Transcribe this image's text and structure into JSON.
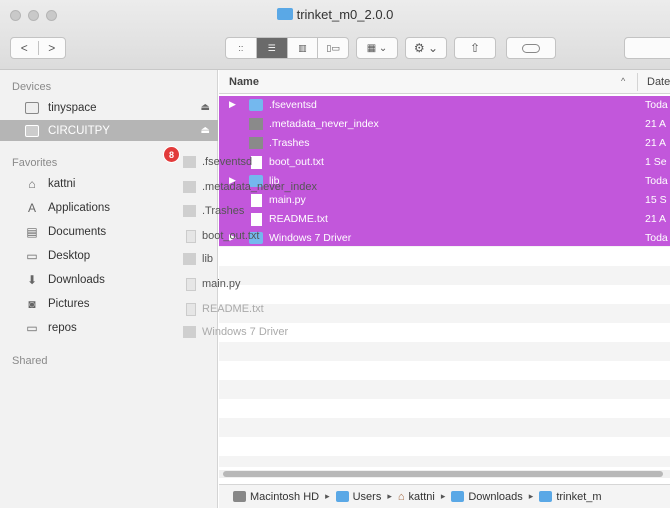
{
  "window": {
    "title": "trinket_m0_2.0.0"
  },
  "toolbar": {
    "back": "<",
    "forward": ">",
    "view_icon": "::",
    "view_list": "☰",
    "view_column": "▥",
    "view_cover": "▯▭",
    "arrange": "▦ ⌄",
    "action": "⚙ ⌄",
    "share": "⇧"
  },
  "sidebar": {
    "devices_heading": "Devices",
    "devices": [
      {
        "label": "tinyspace",
        "icon": "drive-icon"
      },
      {
        "label": "CIRCUITPY",
        "icon": "drive-icon"
      }
    ],
    "eject_glyph": "⏏",
    "favorites_heading": "Favorites",
    "favorites": [
      {
        "label": "kattni",
        "icon": "home-icon",
        "glyph": "⌂"
      },
      {
        "label": "Applications",
        "icon": "applications-icon",
        "glyph": "A"
      },
      {
        "label": "Documents",
        "icon": "documents-icon",
        "glyph": "▤"
      },
      {
        "label": "Desktop",
        "icon": "desktop-icon",
        "glyph": "▭"
      },
      {
        "label": "Downloads",
        "icon": "downloads-icon",
        "glyph": "⬇"
      },
      {
        "label": "Pictures",
        "icon": "pictures-icon",
        "glyph": "◙"
      },
      {
        "label": "repos",
        "icon": "folder-icon",
        "glyph": "▭"
      }
    ],
    "shared_heading": "Shared"
  },
  "columns": {
    "name": "Name",
    "sort_glyph": "^",
    "date": "Date"
  },
  "files": [
    {
      "name": ".fseventsd",
      "date": "Toda",
      "kind": "folder",
      "expandable": true
    },
    {
      "name": ".metadata_never_index",
      "date": "21 A",
      "kind": "gray",
      "expandable": false
    },
    {
      "name": ".Trashes",
      "date": "21 A",
      "kind": "gray",
      "expandable": false
    },
    {
      "name": "boot_out.txt",
      "date": "1 Se",
      "kind": "doc",
      "expandable": false
    },
    {
      "name": "lib",
      "date": "Toda",
      "kind": "folder",
      "expandable": true
    },
    {
      "name": "main.py",
      "date": "15 S",
      "kind": "doc",
      "expandable": false
    },
    {
      "name": "README.txt",
      "date": "21 A",
      "kind": "doc",
      "expandable": false
    },
    {
      "name": "Windows 7 Driver",
      "date": "Toda",
      "kind": "folder",
      "expandable": true
    }
  ],
  "tri_glyph": "▶",
  "drag": {
    "badge": "8",
    "items": [
      {
        "name": ".fseventsd"
      },
      {
        "name": ".metadata_never_index"
      },
      {
        "name": ".Trashes"
      },
      {
        "name": "boot_out.txt"
      },
      {
        "name": "lib"
      },
      {
        "name": "main.py"
      },
      {
        "name": "README.txt"
      },
      {
        "name": "Windows 7 Driver"
      }
    ]
  },
  "pathbar": {
    "arrow": "▸",
    "crumbs": [
      {
        "label": "Macintosh HD",
        "icon": "hd"
      },
      {
        "label": "Users",
        "icon": "fd"
      },
      {
        "label": "kattni",
        "icon": "home"
      },
      {
        "label": "Downloads",
        "icon": "fd"
      },
      {
        "label": "trinket_m",
        "icon": "fd"
      }
    ]
  }
}
